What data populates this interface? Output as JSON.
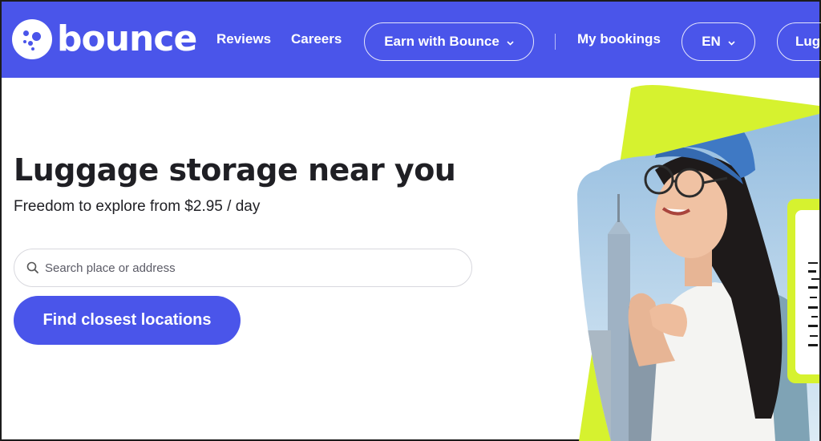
{
  "header": {
    "brand": "bounce",
    "nav": {
      "reviews": "Reviews",
      "careers": "Careers",
      "earn": "Earn with Bounce",
      "my_bookings": "My bookings",
      "language": "EN",
      "luggage_cut": "Lug"
    }
  },
  "hero": {
    "title": "Luggage storage near you",
    "subtitle": "Freedom to explore from $2.95 / day",
    "search_placeholder": "Search place or address",
    "cta": "Find closest locations"
  },
  "icons": {
    "logo": "bounce-logo-icon",
    "search": "search-icon",
    "chevron": "chevron-down-icon"
  },
  "colors": {
    "brand": "#4a55ea",
    "accent_lime": "#d6f22f",
    "text": "#1f1f24"
  }
}
